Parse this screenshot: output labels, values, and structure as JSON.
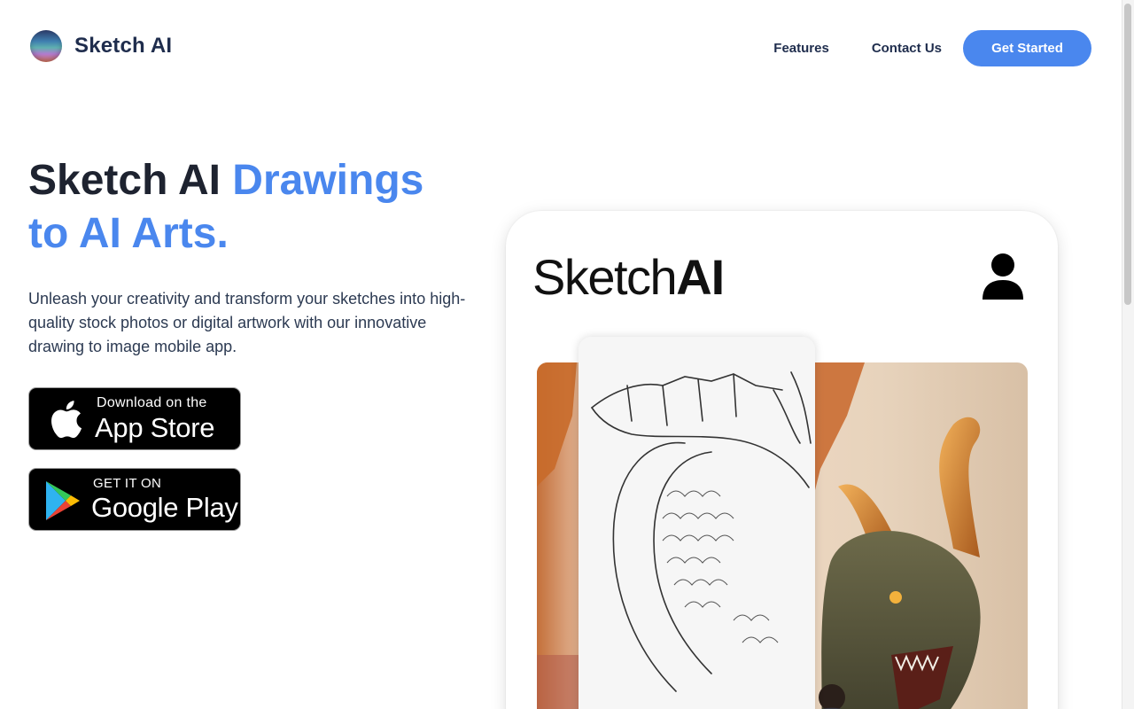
{
  "header": {
    "brand_name": "Sketch AI",
    "nav": {
      "features": "Features",
      "contact": "Contact Us",
      "cta": "Get Started"
    }
  },
  "hero": {
    "title_main": "Sketch AI ",
    "title_accent": "Drawings to AI Arts.",
    "description": "Unleash your creativity and transform your sketches into high-quality stock photos or digital artwork with our innovative drawing to image mobile app."
  },
  "badges": {
    "apple": {
      "small": "Download on the",
      "big": "App Store"
    },
    "google": {
      "small": "GET IT ON",
      "big": "Google Play"
    }
  },
  "mockup": {
    "app_logo_light": "Sketch",
    "app_logo_bold": "AI"
  },
  "colors": {
    "accent": "#4a87ee",
    "heading": "#1e2330",
    "brand_text": "#1f2d4d"
  },
  "icons": [
    "brand-logo-icon",
    "apple-icon",
    "google-play-icon",
    "user-profile-icon"
  ]
}
